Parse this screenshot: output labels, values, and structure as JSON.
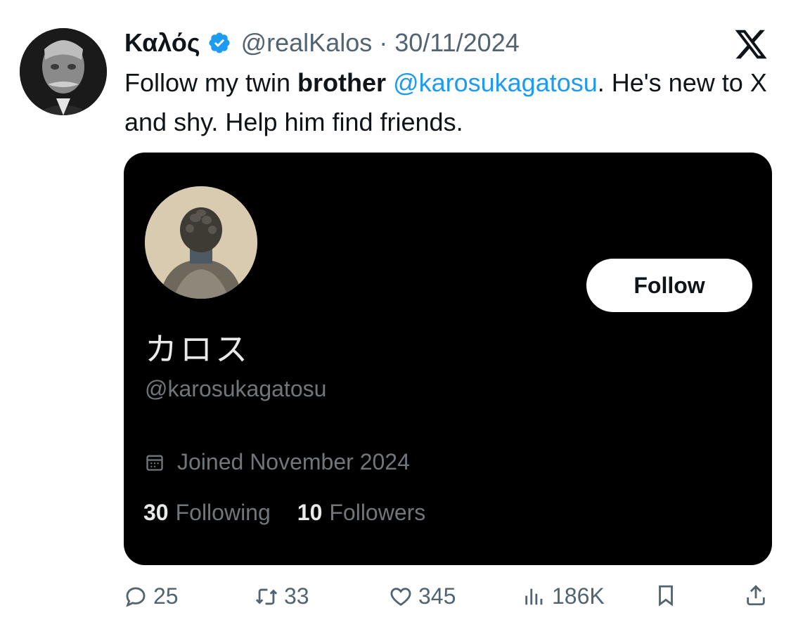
{
  "author": {
    "display_name": "Καλός",
    "handle_date": "@realKalos · 30/11/2024"
  },
  "tweet": {
    "text_part1": "Follow my twin ",
    "text_bold": "brother",
    "text_space": " ",
    "mention": "@karosukagatosu",
    "text_part2": ". He's new to X and shy. Help him find friends."
  },
  "card": {
    "name": "カロス",
    "handle": "@karosukagatosu",
    "follow_label": "Follow",
    "joined": "Joined November 2024",
    "following_count": "30",
    "following_label": "Following",
    "followers_count": "10",
    "followers_label": "Followers"
  },
  "actions": {
    "replies": "25",
    "reposts": "33",
    "likes": "345",
    "views": "186K"
  },
  "colors": {
    "accent": "#1d9bf0",
    "muted": "#536471",
    "card_bg": "#000000"
  },
  "icons": [
    "verified-badge-icon",
    "x-logo-icon",
    "calendar-icon",
    "reply-icon",
    "repost-icon",
    "like-icon",
    "views-icon",
    "bookmark-icon",
    "share-icon"
  ]
}
